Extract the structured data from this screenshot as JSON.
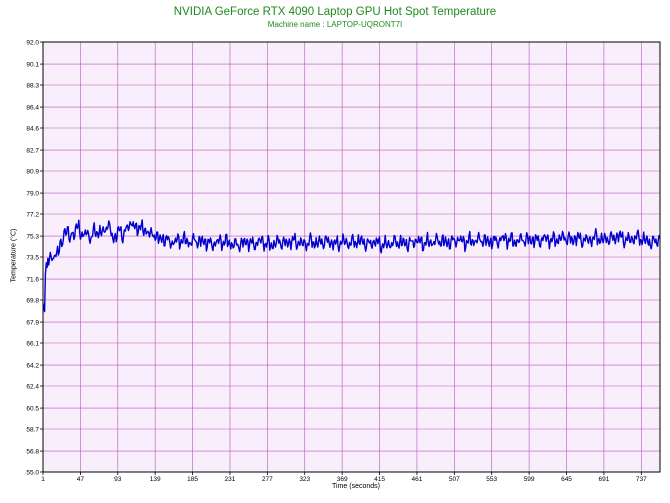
{
  "chart_data": {
    "type": "line",
    "title": "NVIDIA GeForce RTX 4090 Laptop GPU Hot Spot Temperature",
    "subtitle": "Machine name : LAPTOP-UQRONT7I",
    "xlabel": "Time (seconds)",
    "ylabel": "Temperature (°C)",
    "xlim": [
      1,
      760
    ],
    "ylim": [
      55.0,
      92.0
    ],
    "grid": true,
    "legend": "none",
    "y_ticks": [
      "55.0",
      "56.8",
      "58.7",
      "60.5",
      "62.4",
      "64.2",
      "66.1",
      "67.9",
      "69.8",
      "71.6",
      "73.5",
      "75.3",
      "77.2",
      "79.0",
      "80.9",
      "82.7",
      "84.6",
      "86.4",
      "88.3",
      "90.1",
      "92.0"
    ],
    "x_ticks": [
      "1",
      "47",
      "93",
      "139",
      "185",
      "231",
      "277",
      "323",
      "369",
      "415",
      "461",
      "507",
      "553",
      "599",
      "645",
      "691",
      "737"
    ],
    "series": [
      {
        "color": "#0000cc",
        "x": [
          1,
          2,
          3,
          4,
          5,
          6,
          7,
          8,
          10,
          12,
          14,
          16,
          18,
          20,
          22,
          24,
          26,
          28,
          30,
          32,
          34,
          36,
          38,
          40,
          45,
          50,
          55,
          60,
          65,
          70,
          75,
          80,
          85,
          90,
          95,
          100,
          105,
          110,
          115,
          120,
          125,
          130,
          135,
          140,
          145,
          150,
          160,
          170,
          180,
          190,
          200,
          210,
          220,
          230,
          240,
          250,
          260,
          270,
          280,
          290,
          300,
          310,
          320,
          330,
          340,
          350,
          360,
          370,
          380,
          390,
          400,
          410,
          420,
          430,
          440,
          450,
          460,
          470,
          480,
          490,
          500,
          510,
          520,
          530,
          540,
          550,
          560,
          570,
          580,
          590,
          600,
          610,
          620,
          630,
          640,
          650,
          660,
          670,
          680,
          690,
          700,
          710,
          720,
          730,
          740,
          750,
          760
        ],
        "y": [
          69.5,
          69.1,
          68.8,
          72.0,
          73.0,
          72.6,
          73.4,
          72.8,
          73.9,
          73.2,
          74.0,
          73.6,
          74.1,
          73.5,
          74.8,
          74.3,
          75.4,
          76.3,
          75.0,
          75.9,
          74.6,
          76.1,
          75.2,
          75.6,
          76.2,
          75.1,
          75.8,
          74.9,
          76.0,
          75.4,
          75.7,
          76.3,
          75.5,
          75.1,
          75.9,
          75.3,
          76.1,
          76.5,
          75.8,
          76.3,
          75.6,
          75.9,
          75.2,
          75.5,
          74.9,
          75.1,
          74.7,
          75.0,
          74.8,
          74.9,
          74.8,
          74.6,
          74.9,
          74.7,
          74.5,
          74.8,
          74.6,
          74.9,
          74.5,
          74.8,
          74.7,
          74.9,
          74.6,
          74.8,
          74.7,
          74.9,
          74.6,
          74.8,
          74.7,
          74.9,
          74.6,
          74.8,
          74.5,
          74.7,
          74.8,
          74.6,
          74.9,
          74.7,
          74.8,
          74.9,
          74.7,
          75.0,
          74.8,
          74.9,
          75.0,
          74.8,
          74.9,
          75.1,
          74.8,
          75.0,
          75.0,
          74.9,
          75.1,
          74.9,
          75.2,
          75.0,
          75.1,
          74.9,
          75.2,
          75.0,
          75.1,
          75.3,
          74.9,
          75.2,
          75.0,
          74.7,
          75.1
        ]
      }
    ]
  }
}
